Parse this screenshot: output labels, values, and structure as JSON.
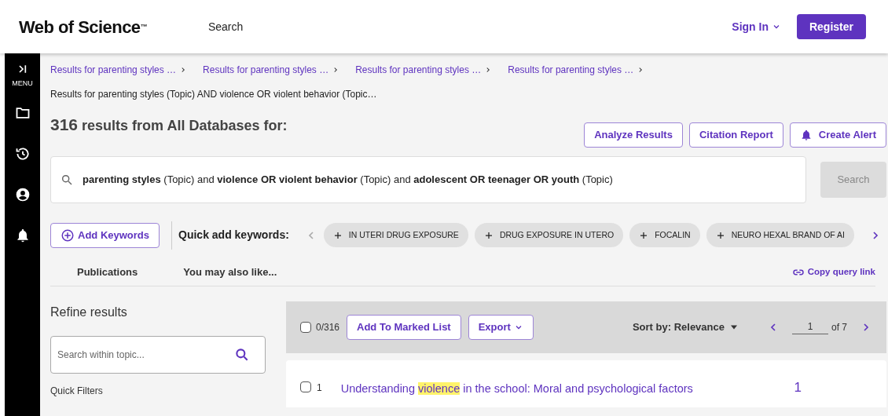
{
  "header": {
    "logo": "Web of Science",
    "logo_mark": "™",
    "nav": [
      "Search"
    ],
    "sign_in": "Sign In",
    "register": "Register"
  },
  "sidebar": {
    "menu_label": "MENU"
  },
  "breadcrumbs": [
    "Results for parenting styles …",
    "Results for parenting styles …",
    "Results for parenting styles …",
    "Results for parenting styles …"
  ],
  "current_page": "Results for parenting styles (Topic) AND violence OR violent behavior (Topic…",
  "results_heading": {
    "count": "316",
    "text": "results from All Databases for:"
  },
  "actions": [
    {
      "label": "Analyze Results",
      "kind": "plain"
    },
    {
      "label": "Citation Report",
      "kind": "plain"
    },
    {
      "label": "Create Alert",
      "kind": "alert"
    }
  ],
  "query": "**parenting styles** (Topic) and **violence OR violent behavior** (Topic) and **adolescent OR teenager OR youth** (Topic)",
  "search_button": {
    "label": "Search",
    "disabled": true
  },
  "add_keywords": "Add Keywords",
  "quick_add": {
    "label": "Quick add keywords:",
    "keywords": [
      "IN UTERI DRUG EXPOSURE",
      "DRUG EXPOSURE IN UTERO",
      "FOCALIN",
      "NEURO HEXAL BRAND OF AI"
    ]
  },
  "tabs": [
    {
      "label": "Publications",
      "selected": false
    },
    {
      "label": "You may also like...",
      "selected": false
    }
  ],
  "copy_link": "Copy query link",
  "refine": {
    "title": "Refine results",
    "placeholder": "Search within topic...",
    "quick_filters": "Quick Filters"
  },
  "toolbar": {
    "selected_count": "0/316",
    "checked": false,
    "add_to_list": "Add To Marked List",
    "export": "Export",
    "sort": "Sort by: Relevance",
    "page": "1",
    "of": "of 7"
  },
  "results": [
    {
      "number": "1",
      "checked": false,
      "title_before": "Understanding ",
      "title_highlight": "violence",
      "title_after": " in the school: Moral and psychological factors",
      "citations": "1"
    }
  ]
}
